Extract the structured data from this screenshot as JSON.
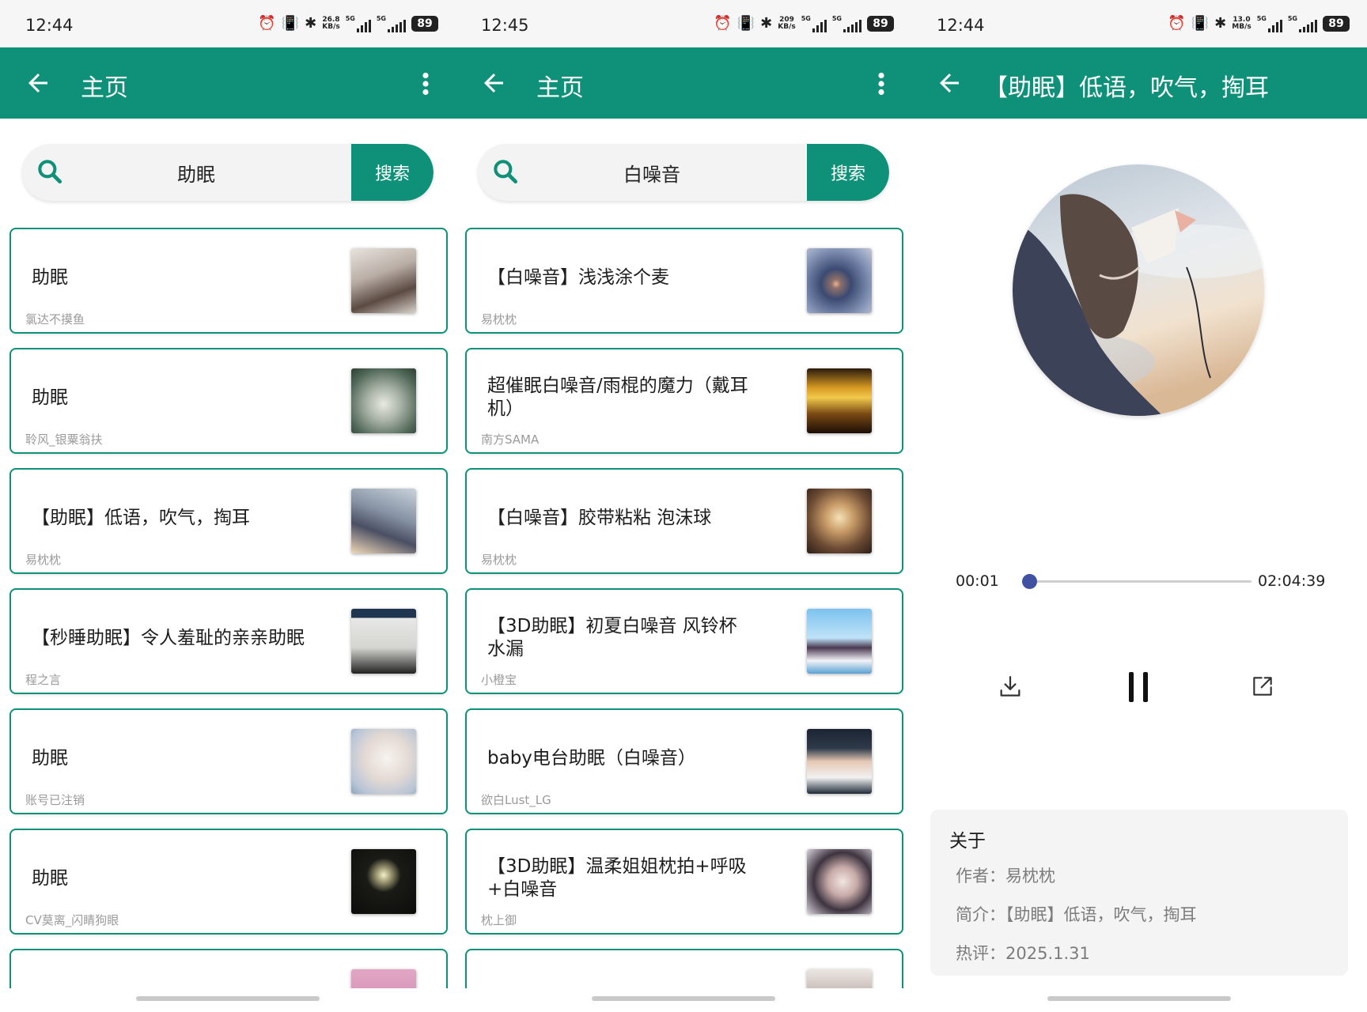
{
  "colors": {
    "primary": "#0f9179",
    "progress": "#3f51a0",
    "card_border": "#0f9179"
  },
  "icons": {
    "back": "arrow-left-icon",
    "more": "more-vertical-icon",
    "search": "search-icon",
    "download": "download-icon",
    "pause": "pause-icon",
    "share": "share-icon"
  },
  "screens": [
    {
      "status": {
        "time": "12:44",
        "speed_value": "26.8",
        "speed_unit": "KB/s",
        "net1": "5G",
        "net2": "5G",
        "battery": "89"
      },
      "appbar": {
        "title": "主页"
      },
      "search": {
        "query": "助眠",
        "button": "搜索"
      },
      "results": [
        {
          "title": "助眠",
          "author": "氯达不摸鱼"
        },
        {
          "title": "助眠",
          "author": "聆风_银粟翁扶"
        },
        {
          "title": "【助眠】低语，吹气，掏耳",
          "author": "易枕枕"
        },
        {
          "title": "【秒睡助眠】令人羞耻的亲亲助眠",
          "author": "程之言"
        },
        {
          "title": "助眠",
          "author": "账号已注销"
        },
        {
          "title": "助眠",
          "author": "CV莫离_闪睛狗眼"
        },
        {
          "title": "",
          "author": ""
        }
      ]
    },
    {
      "status": {
        "time": "12:45",
        "speed_value": "209",
        "speed_unit": "KB/s",
        "net1": "5G",
        "net2": "5G",
        "battery": "89"
      },
      "appbar": {
        "title": "主页"
      },
      "search": {
        "query": "白噪音",
        "button": "搜索"
      },
      "results": [
        {
          "title": "【白噪音】浅浅涂个麦",
          "author": "易枕枕"
        },
        {
          "title": "超催眠白噪音/雨棍的魔力（戴耳机）",
          "author": "南方SAMA"
        },
        {
          "title": "【白噪音】胶带粘粘 泡沫球",
          "author": "易枕枕"
        },
        {
          "title": "【3D助眠】初夏白噪音 风铃杯 水漏",
          "author": "小橙宝"
        },
        {
          "title": "baby电台助眠（白噪音）",
          "author": "欲白Lust_LG"
        },
        {
          "title": "【3D助眠】温柔姐姐枕拍+呼吸+白噪音",
          "author": "枕上御"
        },
        {
          "title": "",
          "author": ""
        }
      ]
    },
    {
      "status": {
        "time": "12:44",
        "speed_value": "13.0",
        "speed_unit": "MB/s",
        "net1": "5G",
        "net2": "5G",
        "battery": "89"
      },
      "appbar": {
        "title": "【助眠】低语，吹气，掏耳"
      },
      "player": {
        "current_time": "00:01",
        "total_time": "02:04:39",
        "progress": 0.0
      },
      "about": {
        "title": "关于",
        "author_line": "作者：易枕枕",
        "intro_line": "简介：【助眠】低语，吹气，掏耳",
        "comment_line": "热评：2025.1.31"
      }
    }
  ]
}
